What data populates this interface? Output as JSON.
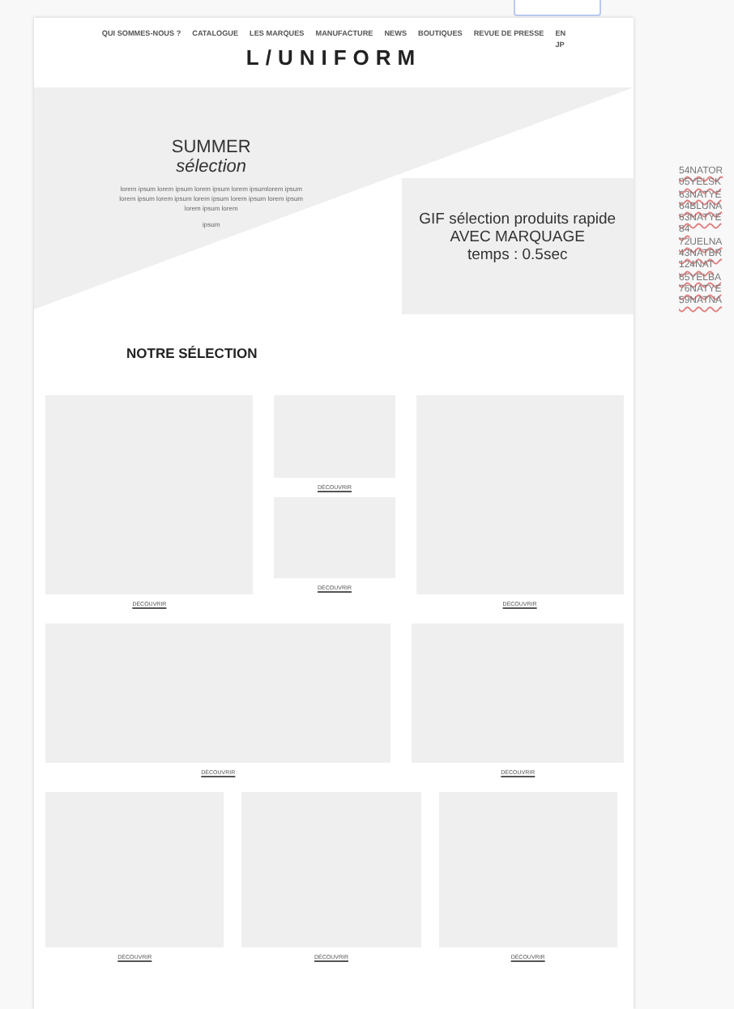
{
  "nav": {
    "items": [
      "QUI SOMMES-NOUS ?",
      "CATALOGUE",
      "LES MARQUES",
      "MANUFACTURE",
      "NEWS",
      "BOUTIQUES",
      "REVUE DE PRESSE"
    ],
    "languages": [
      "EN",
      "JP"
    ]
  },
  "logo": "L/UNIFORM",
  "hero": {
    "title": "SUMMER",
    "subtitle": "sélection",
    "text": "lorem ipsum lorem ipsum lorem ipsum lorem ipsumlorem ipsum lorem ipsum lorem ipsum lorem ipsum lorem ipsum lorem ipsum lorem ipsum lorem",
    "link": "ipsum"
  },
  "gif_box": [
    "GIF sélection produits rapide",
    "AVEC MARQUAGE",
    "temps : 0.5sec"
  ],
  "section_title": "NOTRE SÉLECTION",
  "product_rows": [
    {
      "items": [
        {
          "kind": "tile",
          "link": "DÉCOUVRIR"
        },
        {
          "kind": "stack",
          "tiles": [
            {
              "link": "DÉCOUVRIR"
            },
            {
              "link": "DÉCOUVRIR"
            }
          ]
        },
        {
          "kind": "tile",
          "link": "DÉCOUVRIR"
        }
      ]
    },
    {
      "items": [
        {
          "kind": "wide",
          "link": "DÉCOUVRIR"
        },
        {
          "kind": "tile",
          "link": "DÉCOUVRIR"
        }
      ]
    },
    {
      "items": [
        {
          "kind": "tile",
          "link": "DÉCOUVRIR"
        },
        {
          "kind": "tile",
          "link": "DÉCOUVRIR"
        },
        {
          "kind": "tile",
          "link": "DÉCOUVRIR"
        }
      ]
    }
  ],
  "side_notes": [
    "54NATOR",
    "05YELSK",
    "63NATYE",
    "64BLUNA",
    "63NATYE",
    "84",
    "72UELNA",
    "43NATBR",
    "124NAT",
    "65YELBA",
    "76NATYE",
    "59NATNA"
  ]
}
